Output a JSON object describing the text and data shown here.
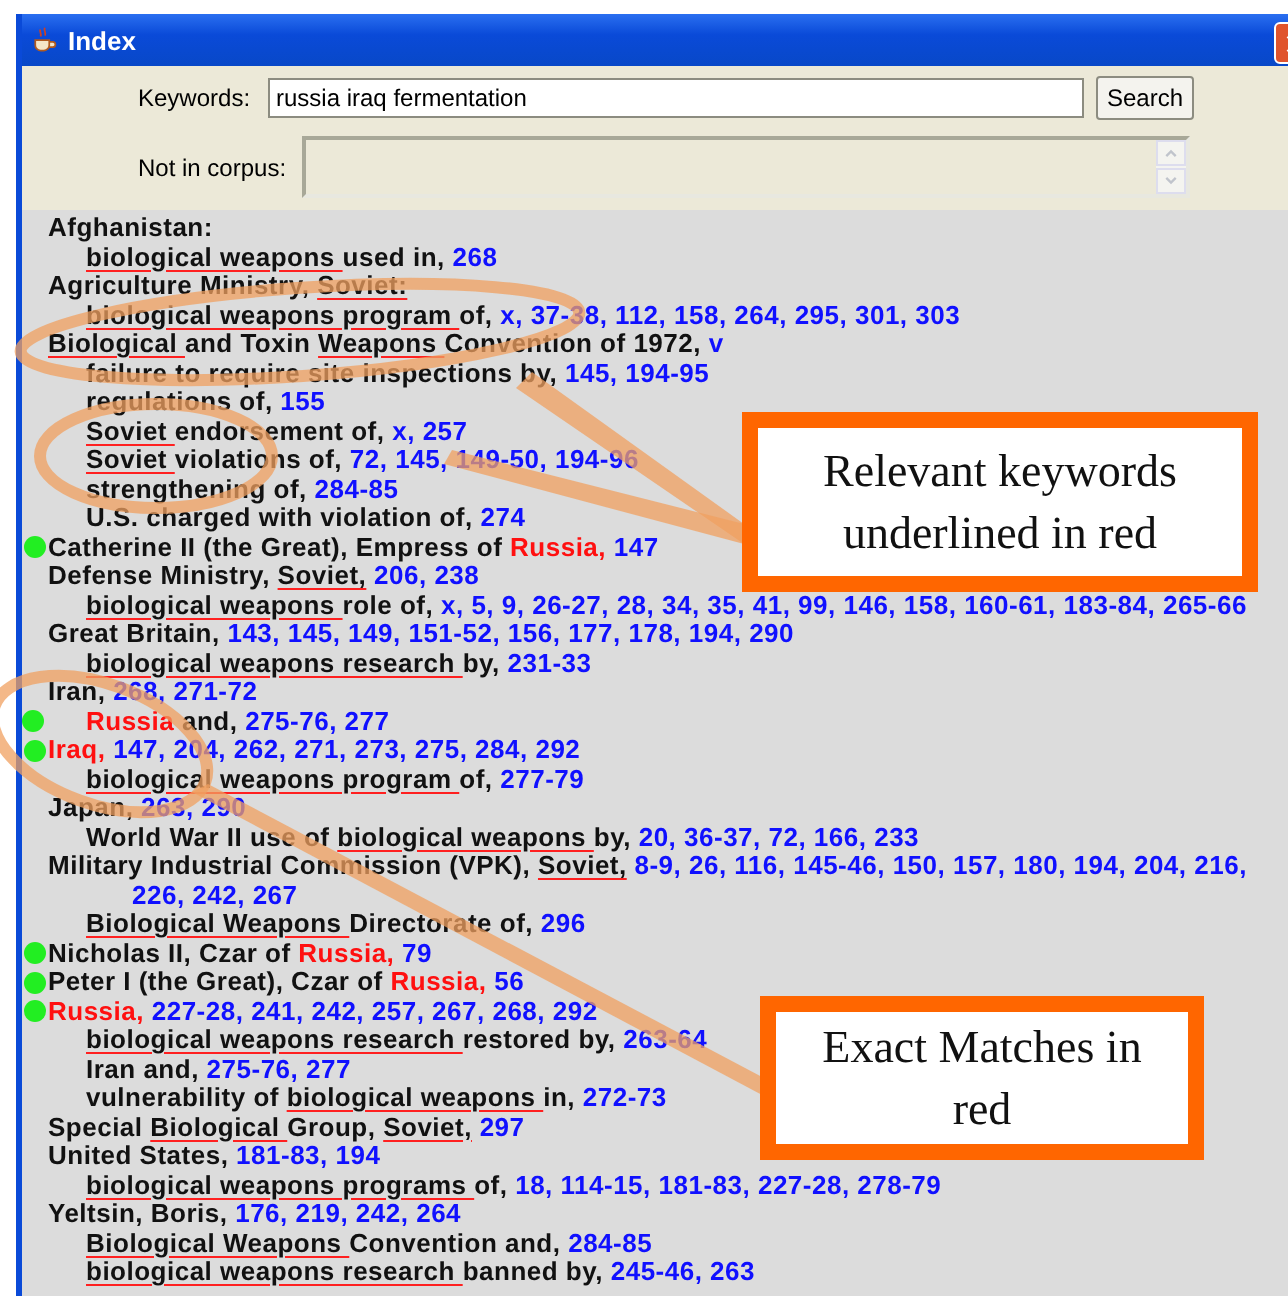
{
  "window": {
    "title": "Index"
  },
  "search": {
    "keywords_label": "Keywords:",
    "keywords_value": "russia iraq fermentation",
    "button": "Search",
    "not_in_corpus_label": "Not in corpus:"
  },
  "index": [
    {
      "marked": false,
      "parts": [
        {
          "kind": "text",
          "text": "Afghanistan:"
        }
      ],
      "children": [
        {
          "marked": false,
          "parts": [
            {
              "kind": "keyword",
              "text": "biological weapons "
            },
            {
              "kind": "text",
              "text": "used in, "
            },
            {
              "kind": "pages",
              "text": "268"
            }
          ]
        }
      ]
    },
    {
      "marked": false,
      "parts": [
        {
          "kind": "text",
          "text": "Agriculture Ministry, "
        },
        {
          "kind": "keyword",
          "text": "Soviet:"
        }
      ],
      "children": [
        {
          "marked": false,
          "parts": [
            {
              "kind": "keyword",
              "text": "biological weapons program "
            },
            {
              "kind": "text",
              "text": "of, "
            },
            {
              "kind": "pages",
              "text": "x, 37-38, 112, 158, 264, 295, 301, 303"
            }
          ]
        }
      ]
    },
    {
      "marked": false,
      "parts": [
        {
          "kind": "keyword",
          "text": "Biological "
        },
        {
          "kind": "text",
          "text": "and Toxin "
        },
        {
          "kind": "keyword",
          "text": "Weapons "
        },
        {
          "kind": "text",
          "text": "Convention of 1972, "
        },
        {
          "kind": "pages",
          "text": "v"
        }
      ],
      "children": [
        {
          "marked": false,
          "parts": [
            {
              "kind": "text",
              "text": "failure to require site inspections by, "
            },
            {
              "kind": "pages",
              "text": "145, 194-95"
            }
          ]
        },
        {
          "marked": false,
          "parts": [
            {
              "kind": "text",
              "text": "regulations of, "
            },
            {
              "kind": "pages",
              "text": "155"
            }
          ]
        },
        {
          "marked": false,
          "parts": [
            {
              "kind": "keyword",
              "text": "Soviet "
            },
            {
              "kind": "text",
              "text": "endorsement of, "
            },
            {
              "kind": "pages",
              "text": "x, 257"
            }
          ]
        },
        {
          "marked": false,
          "parts": [
            {
              "kind": "keyword",
              "text": "Soviet "
            },
            {
              "kind": "text",
              "text": "violations of, "
            },
            {
              "kind": "pages",
              "text": "72, 145, 149-50, 194-96"
            }
          ]
        },
        {
          "marked": false,
          "parts": [
            {
              "kind": "text",
              "text": "strengthening of, "
            },
            {
              "kind": "pages",
              "text": "284-85"
            }
          ]
        },
        {
          "marked": false,
          "parts": [
            {
              "kind": "text",
              "text": "U.S. charged with violation of, "
            },
            {
              "kind": "pages",
              "text": "274"
            }
          ]
        }
      ]
    },
    {
      "marked": true,
      "parts": [
        {
          "kind": "text",
          "text": "Catherine II (the Great), Empress of "
        },
        {
          "kind": "match",
          "text": "Russia,"
        },
        {
          "kind": "pages",
          "text": " 147"
        }
      ]
    },
    {
      "marked": false,
      "parts": [
        {
          "kind": "text",
          "text": "Defense Ministry, "
        },
        {
          "kind": "keyword",
          "text": "Soviet,"
        },
        {
          "kind": "pages",
          "text": " 206, 238"
        }
      ],
      "children": [
        {
          "marked": false,
          "parts": [
            {
              "kind": "keyword",
              "text": "biological weapons "
            },
            {
              "kind": "text",
              "text": "role of, "
            },
            {
              "kind": "pages",
              "text": "x, 5, 9, 26-27, 28, 34, 35, 41, 99, 146, 158, 160-61, 183-84, 265-66"
            }
          ]
        }
      ]
    },
    {
      "marked": false,
      "parts": [
        {
          "kind": "text",
          "text": "Great Britain, "
        },
        {
          "kind": "pages",
          "text": "143, 145, 149, 151-52, 156, 177, 178, 194, 290"
        }
      ],
      "children": [
        {
          "marked": false,
          "parts": [
            {
              "kind": "keyword",
              "text": "biological weapons research "
            },
            {
              "kind": "text",
              "text": "by, "
            },
            {
              "kind": "pages",
              "text": "231-33"
            }
          ]
        }
      ]
    },
    {
      "marked": false,
      "parts": [
        {
          "kind": "text",
          "text": "Iran, "
        },
        {
          "kind": "pages",
          "text": "268, 271-72"
        }
      ],
      "children": [
        {
          "marked": true,
          "parts": [
            {
              "kind": "match",
              "text": "Russia"
            },
            {
              "kind": "text",
              "text": " and, "
            },
            {
              "kind": "pages",
              "text": "275-76, 277"
            }
          ]
        }
      ]
    },
    {
      "marked": true,
      "parts": [
        {
          "kind": "match",
          "text": "Iraq,"
        },
        {
          "kind": "pages",
          "text": " 147, 204, 262, 271, 273, 275, 284, 292"
        }
      ],
      "children": [
        {
          "marked": false,
          "parts": [
            {
              "kind": "keyword",
              "text": "biological weapons program "
            },
            {
              "kind": "text",
              "text": "of, "
            },
            {
              "kind": "pages",
              "text": "277-79"
            }
          ]
        }
      ]
    },
    {
      "marked": false,
      "parts": [
        {
          "kind": "text",
          "text": "Japan, "
        },
        {
          "kind": "pages",
          "text": "263, 290"
        }
      ],
      "children": [
        {
          "marked": false,
          "parts": [
            {
              "kind": "text",
              "text": "World War II use of "
            },
            {
              "kind": "keyword",
              "text": "biological weapons "
            },
            {
              "kind": "text",
              "text": "by, "
            },
            {
              "kind": "pages",
              "text": "20, 36-37, 72, 166, 233"
            }
          ]
        }
      ]
    },
    {
      "marked": false,
      "parts": [
        {
          "kind": "text",
          "text": "Military Industrial Commission (VPK), "
        },
        {
          "kind": "keyword",
          "text": "Soviet,"
        },
        {
          "kind": "pages",
          "text": " 8-9, 26, 116, 145-46, 150, 157, 180, 194, 204, 216, 226, 242, 267"
        }
      ],
      "children": [
        {
          "marked": false,
          "parts": [
            {
              "kind": "keyword",
              "text": "Biological Weapons "
            },
            {
              "kind": "text",
              "text": "Directorate of, "
            },
            {
              "kind": "pages",
              "text": "296"
            }
          ]
        }
      ]
    },
    {
      "marked": true,
      "parts": [
        {
          "kind": "text",
          "text": "Nicholas II, Czar of "
        },
        {
          "kind": "match",
          "text": "Russia,"
        },
        {
          "kind": "pages",
          "text": " 79"
        }
      ]
    },
    {
      "marked": true,
      "parts": [
        {
          "kind": "text",
          "text": "Peter I (the Great), Czar of "
        },
        {
          "kind": "match",
          "text": "Russia,"
        },
        {
          "kind": "pages",
          "text": " 56"
        }
      ]
    },
    {
      "marked": true,
      "parts": [
        {
          "kind": "match",
          "text": "Russia,"
        },
        {
          "kind": "pages",
          "text": " 227-28, 241, 242, 257, 267, 268, 292"
        }
      ],
      "children": [
        {
          "marked": false,
          "parts": [
            {
              "kind": "keyword",
              "text": "biological weapons research "
            },
            {
              "kind": "text",
              "text": "restored by, "
            },
            {
              "kind": "pages",
              "text": "263-64"
            }
          ]
        },
        {
          "marked": false,
          "parts": [
            {
              "kind": "text",
              "text": "Iran and, "
            },
            {
              "kind": "pages",
              "text": "275-76, 277"
            }
          ]
        },
        {
          "marked": false,
          "parts": [
            {
              "kind": "text",
              "text": "vulnerability of "
            },
            {
              "kind": "keyword",
              "text": "biological weapons "
            },
            {
              "kind": "text",
              "text": "in, "
            },
            {
              "kind": "pages",
              "text": "272-73"
            }
          ]
        }
      ]
    },
    {
      "marked": false,
      "parts": [
        {
          "kind": "text",
          "text": "Special "
        },
        {
          "kind": "keyword",
          "text": "Biological "
        },
        {
          "kind": "text",
          "text": "Group, "
        },
        {
          "kind": "keyword",
          "text": "Soviet,"
        },
        {
          "kind": "pages",
          "text": " 297"
        }
      ]
    },
    {
      "marked": false,
      "parts": [
        {
          "kind": "text",
          "text": "United States, "
        },
        {
          "kind": "pages",
          "text": "181-83, 194"
        }
      ],
      "children": [
        {
          "marked": false,
          "parts": [
            {
              "kind": "keyword",
              "text": "biological weapons programs "
            },
            {
              "kind": "text",
              "text": "of, "
            },
            {
              "kind": "pages",
              "text": "18, 114-15, 181-83, 227-28, 278-79"
            }
          ]
        }
      ]
    },
    {
      "marked": false,
      "parts": [
        {
          "kind": "text",
          "text": "Yeltsin, Boris, "
        },
        {
          "kind": "pages",
          "text": "176, 219, 242, 264"
        }
      ],
      "children": [
        {
          "marked": false,
          "parts": [
            {
              "kind": "keyword",
              "text": "Biological Weapons "
            },
            {
              "kind": "text",
              "text": "Convention and, "
            },
            {
              "kind": "pages",
              "text": "284-85"
            }
          ]
        },
        {
          "marked": false,
          "parts": [
            {
              "kind": "keyword",
              "text": "biological weapons research "
            },
            {
              "kind": "text",
              "text": "banned by, "
            },
            {
              "kind": "pages",
              "text": "245-46, 263"
            }
          ]
        }
      ]
    }
  ],
  "annotations": [
    {
      "text": "Relevant keywords underlined in red"
    },
    {
      "text": "Exact Matches in red"
    }
  ]
}
